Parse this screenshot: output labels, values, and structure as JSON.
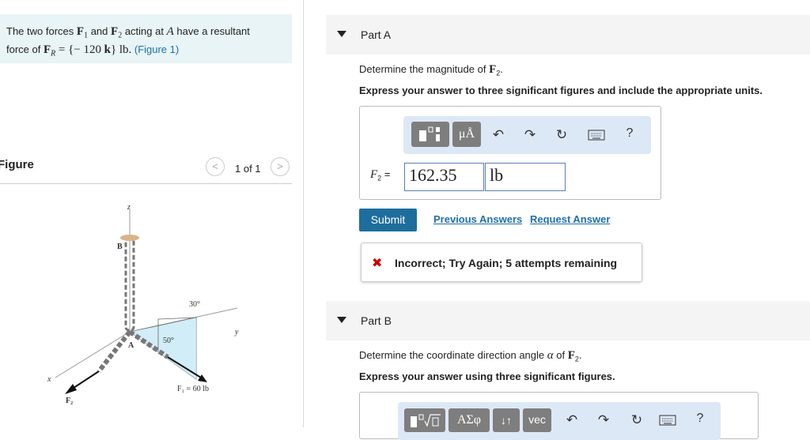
{
  "problem": {
    "intro": "The two forces",
    "f1": "F",
    "f1_sub": "1",
    "and": "and",
    "f2": "F",
    "f2_sub": "2",
    "acting_at": "acting at",
    "point": "A",
    "have": "have a resultant",
    "force_of": "force of",
    "fr": "F",
    "fr_sub": "R",
    "equation": "= {− 120",
    "k": "k",
    "close": "}",
    "unit": "lb.",
    "figure_link": "(Figure 1)"
  },
  "figure_panel": {
    "title": "Figure",
    "prev_icon": "<",
    "next_icon": ">",
    "count": "1 of 1",
    "labels": {
      "z": "z",
      "b": "B",
      "a": "A",
      "y": "y",
      "x": "x",
      "angle30": "30°",
      "angle50": "50°",
      "f1": "F₁ = 60 lb",
      "f2": "F₂"
    }
  },
  "partA": {
    "label": "Part A",
    "question_prefix": "Determine the magnitude of",
    "question_var": "F",
    "question_sub": "2",
    "question_end": ".",
    "instruction": "Express your answer to three significant figures and include the appropriate units.",
    "toolbar": {
      "units_label": "μÅ",
      "help": "?"
    },
    "input_var": "F",
    "input_sub": "2",
    "input_eq": "=",
    "value": "162.35",
    "unit": "lb",
    "submit": "Submit",
    "previous_answers": "Previous Answers",
    "request_answer": "Request Answer",
    "feedback": {
      "icon": "✖",
      "text": "Incorrect; Try Again; 5 attempts remaining",
      "color": "#cc0000"
    }
  },
  "partB": {
    "label": "Part B",
    "question_prefix": "Determine the coordinate direction angle",
    "question_var": "α",
    "question_of": "of",
    "question_f": "F",
    "question_sub": "2",
    "question_end": ".",
    "instruction": "Express your answer using three significant figures.",
    "toolbar": {
      "greek": "ΑΣφ",
      "arrows": "↓↑",
      "vec": "vec",
      "help": "?"
    }
  },
  "colors": {
    "accent": "#1d6e9d",
    "problem_bg": "#e8f4f5",
    "toolbar_bg": "#dde8f7",
    "error": "#cc0000"
  }
}
